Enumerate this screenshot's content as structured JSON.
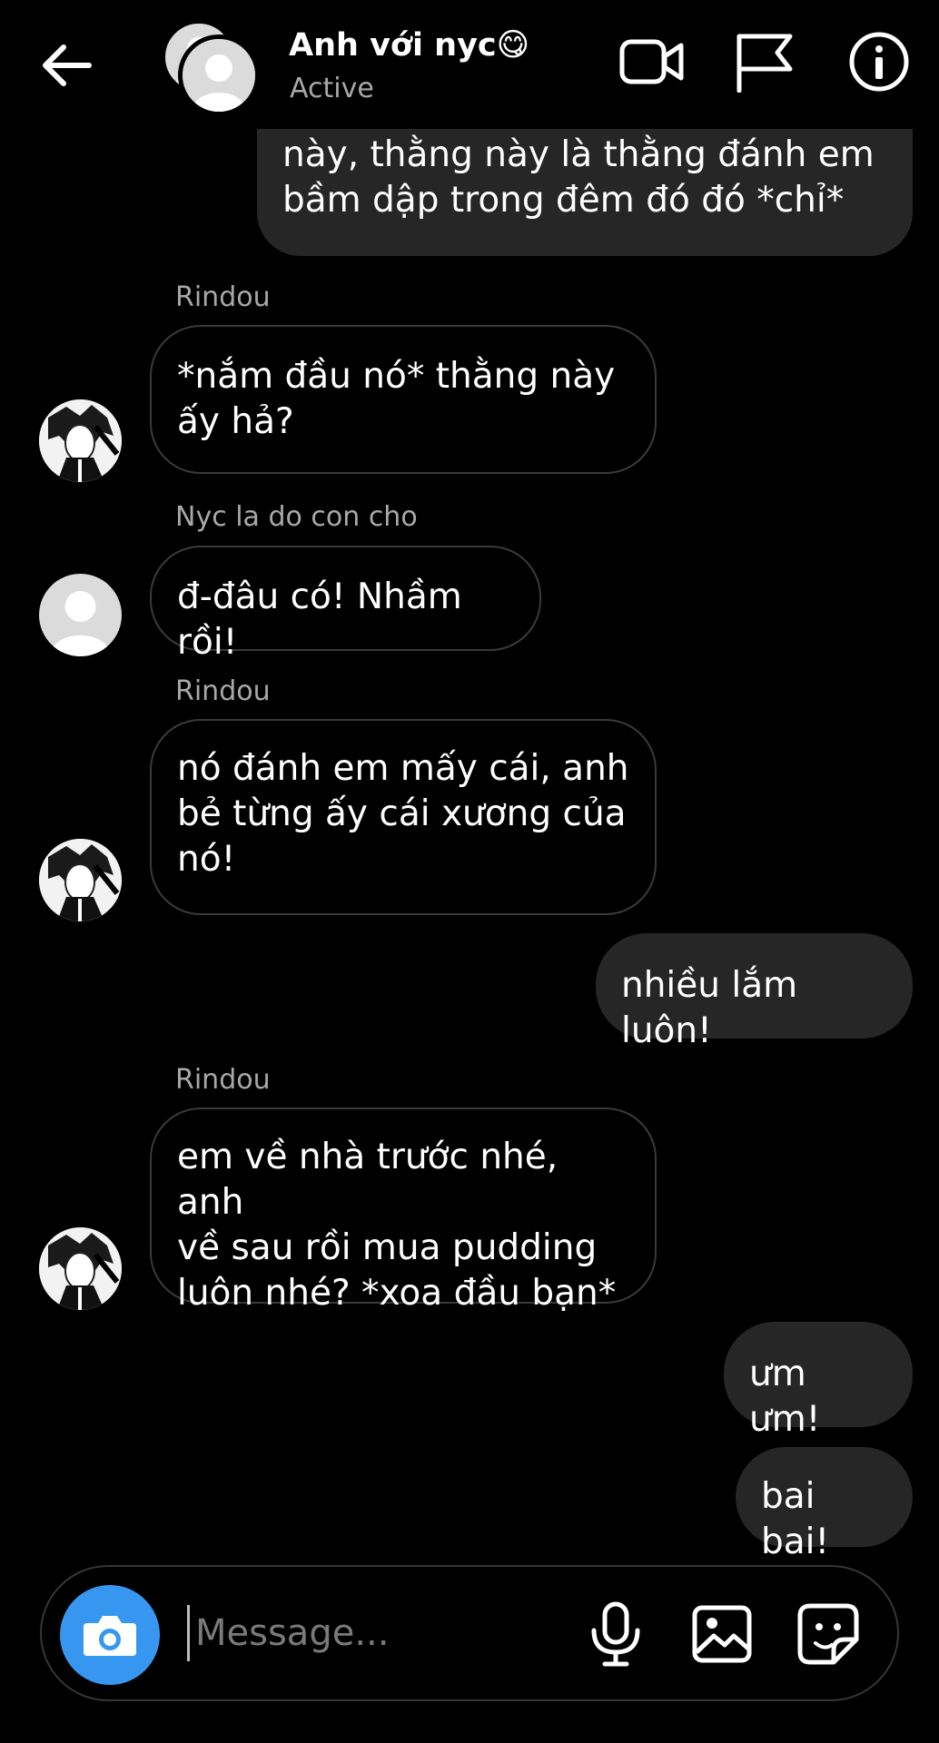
{
  "header": {
    "title": "Anh với nyc😋",
    "status": "Active"
  },
  "messages": [
    {
      "side": "me",
      "text": "này, thằng này là thằng đánh em\nbầm dập trong đêm đó đó *chỉ*"
    },
    {
      "side": "them",
      "sender": "Rindou",
      "avatar": "manga-avatar",
      "text": "*nắm đầu nó* thằng này\nấy hả?"
    },
    {
      "side": "them",
      "sender": "Nyc la do con cho",
      "avatar": "default-avatar",
      "text": "đ-đâu có! Nhầm rồi!"
    },
    {
      "side": "them",
      "sender": "Rindou",
      "avatar": "manga-avatar",
      "text": "nó đánh em mấy cái, anh\nbẻ từng ấy cái xương của\nnó!"
    },
    {
      "side": "me",
      "text": "nhiều lắm luôn!"
    },
    {
      "side": "them",
      "sender": "Rindou",
      "avatar": "manga-avatar",
      "text": "em về nhà trước nhé, anh\nvề sau rồi mua pudding\nluôn nhé? *xoa đầu bạn*"
    },
    {
      "side": "me",
      "text": "ưm ưm!"
    },
    {
      "side": "me",
      "text": "bai bai!"
    }
  ],
  "composer": {
    "placeholder": "Message..."
  },
  "colors": {
    "background": "#000000",
    "my_bubble": "#262626",
    "their_bubble_border": "#3a3a3a",
    "camera_button": "#3797f0",
    "secondary_text": "#a8a8a8"
  }
}
